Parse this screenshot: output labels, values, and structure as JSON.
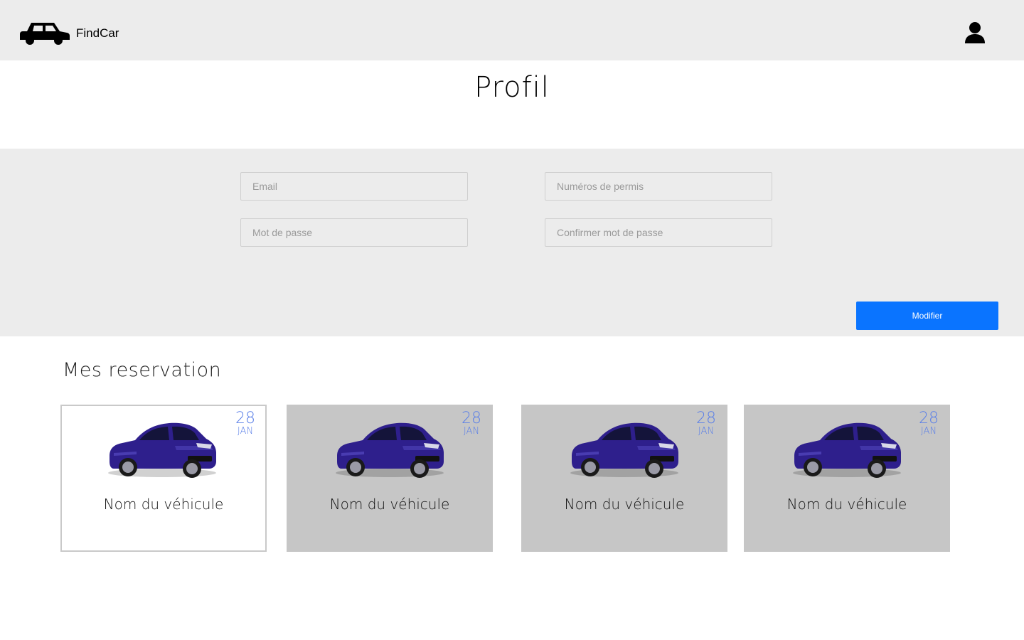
{
  "app": {
    "brand": "FindCar"
  },
  "header": {
    "user_icon": "user-icon",
    "brand_icon": "car-icon"
  },
  "page": {
    "title": "Profil"
  },
  "form": {
    "email_placeholder": "Email",
    "permis_placeholder": "Numéros de permis",
    "password_placeholder": "Mot de passe",
    "confirm_placeholder": "Confirmer mot de passe",
    "submit_label": "Modifier"
  },
  "reservations": {
    "title": "Mes reservation",
    "cards": [
      {
        "day": "28",
        "month": "JAN",
        "name": "Nom du véhicule",
        "selected": true
      },
      {
        "day": "28",
        "month": "JAN",
        "name": "Nom du véhicule",
        "selected": false
      },
      {
        "day": "28",
        "month": "JAN",
        "name": "Nom du véhicule",
        "selected": false
      },
      {
        "day": "28",
        "month": "JAN",
        "name": "Nom du véhicule",
        "selected": false
      }
    ]
  },
  "colors": {
    "header_bg": "#ececec",
    "accent_blue": "#0a74ff",
    "date_blue": "#5a7fe8",
    "card_bg": "#c6c6c6",
    "car_body": "#2e1f8c"
  }
}
